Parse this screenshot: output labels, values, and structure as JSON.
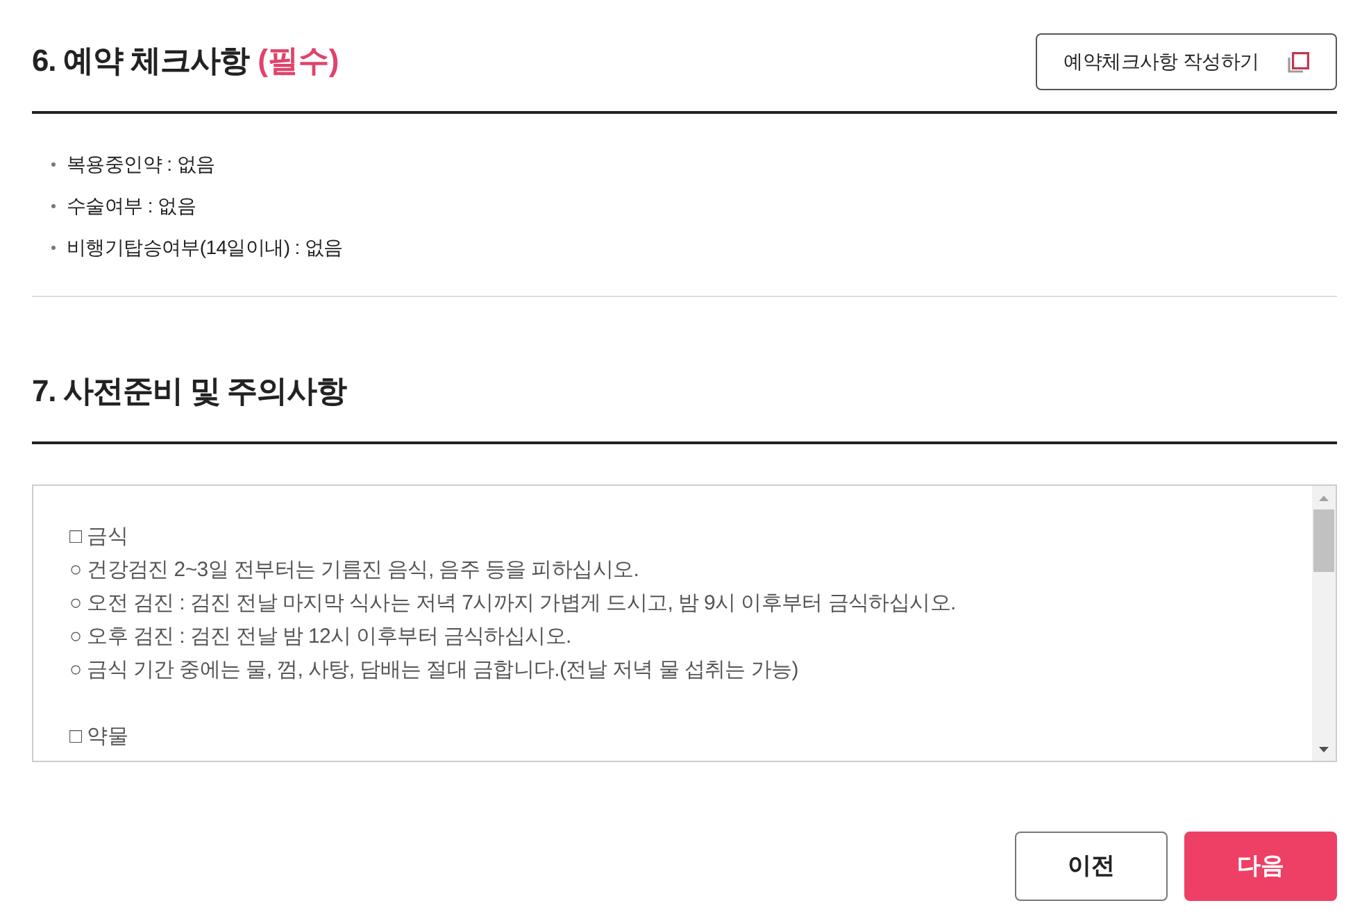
{
  "sections": [
    {
      "title": "6. 예약 체크사항",
      "required_label": "(필수)",
      "action_button": {
        "label": "예약체크사항 작성하기"
      },
      "answers": [
        "복용중인약 : 없음",
        "수술여부 : 없음",
        "비행기탑승여부(14일이내) : 없음"
      ]
    },
    {
      "title": "7. 사전준비 및 주의사항",
      "notice_box": {
        "groups": [
          {
            "title": "□ 금식",
            "items": [
              "○ 건강검진 2~3일 전부터는 기름진 음식, 음주 등을 피하십시오.",
              "○ 오전 검진 : 검진 전날 마지막 식사는 저녁 7시까지 가볍게 드시고, 밤 9시 이후부터 금식하십시오.",
              "○ 오후 검진 : 검진 전날 밤 12시 이후부터 금식하십시오.",
              "○ 금식 기간 중에는 물, 껌, 사탕, 담배는 절대 금합니다.(전날 저녁 물 섭취는 가능)"
            ]
          },
          {
            "title": "□ 약물"
          }
        ]
      }
    }
  ],
  "buttons": [
    {
      "label": "이전",
      "kind": "secondary"
    },
    {
      "label": "다음",
      "kind": "primary"
    }
  ]
}
